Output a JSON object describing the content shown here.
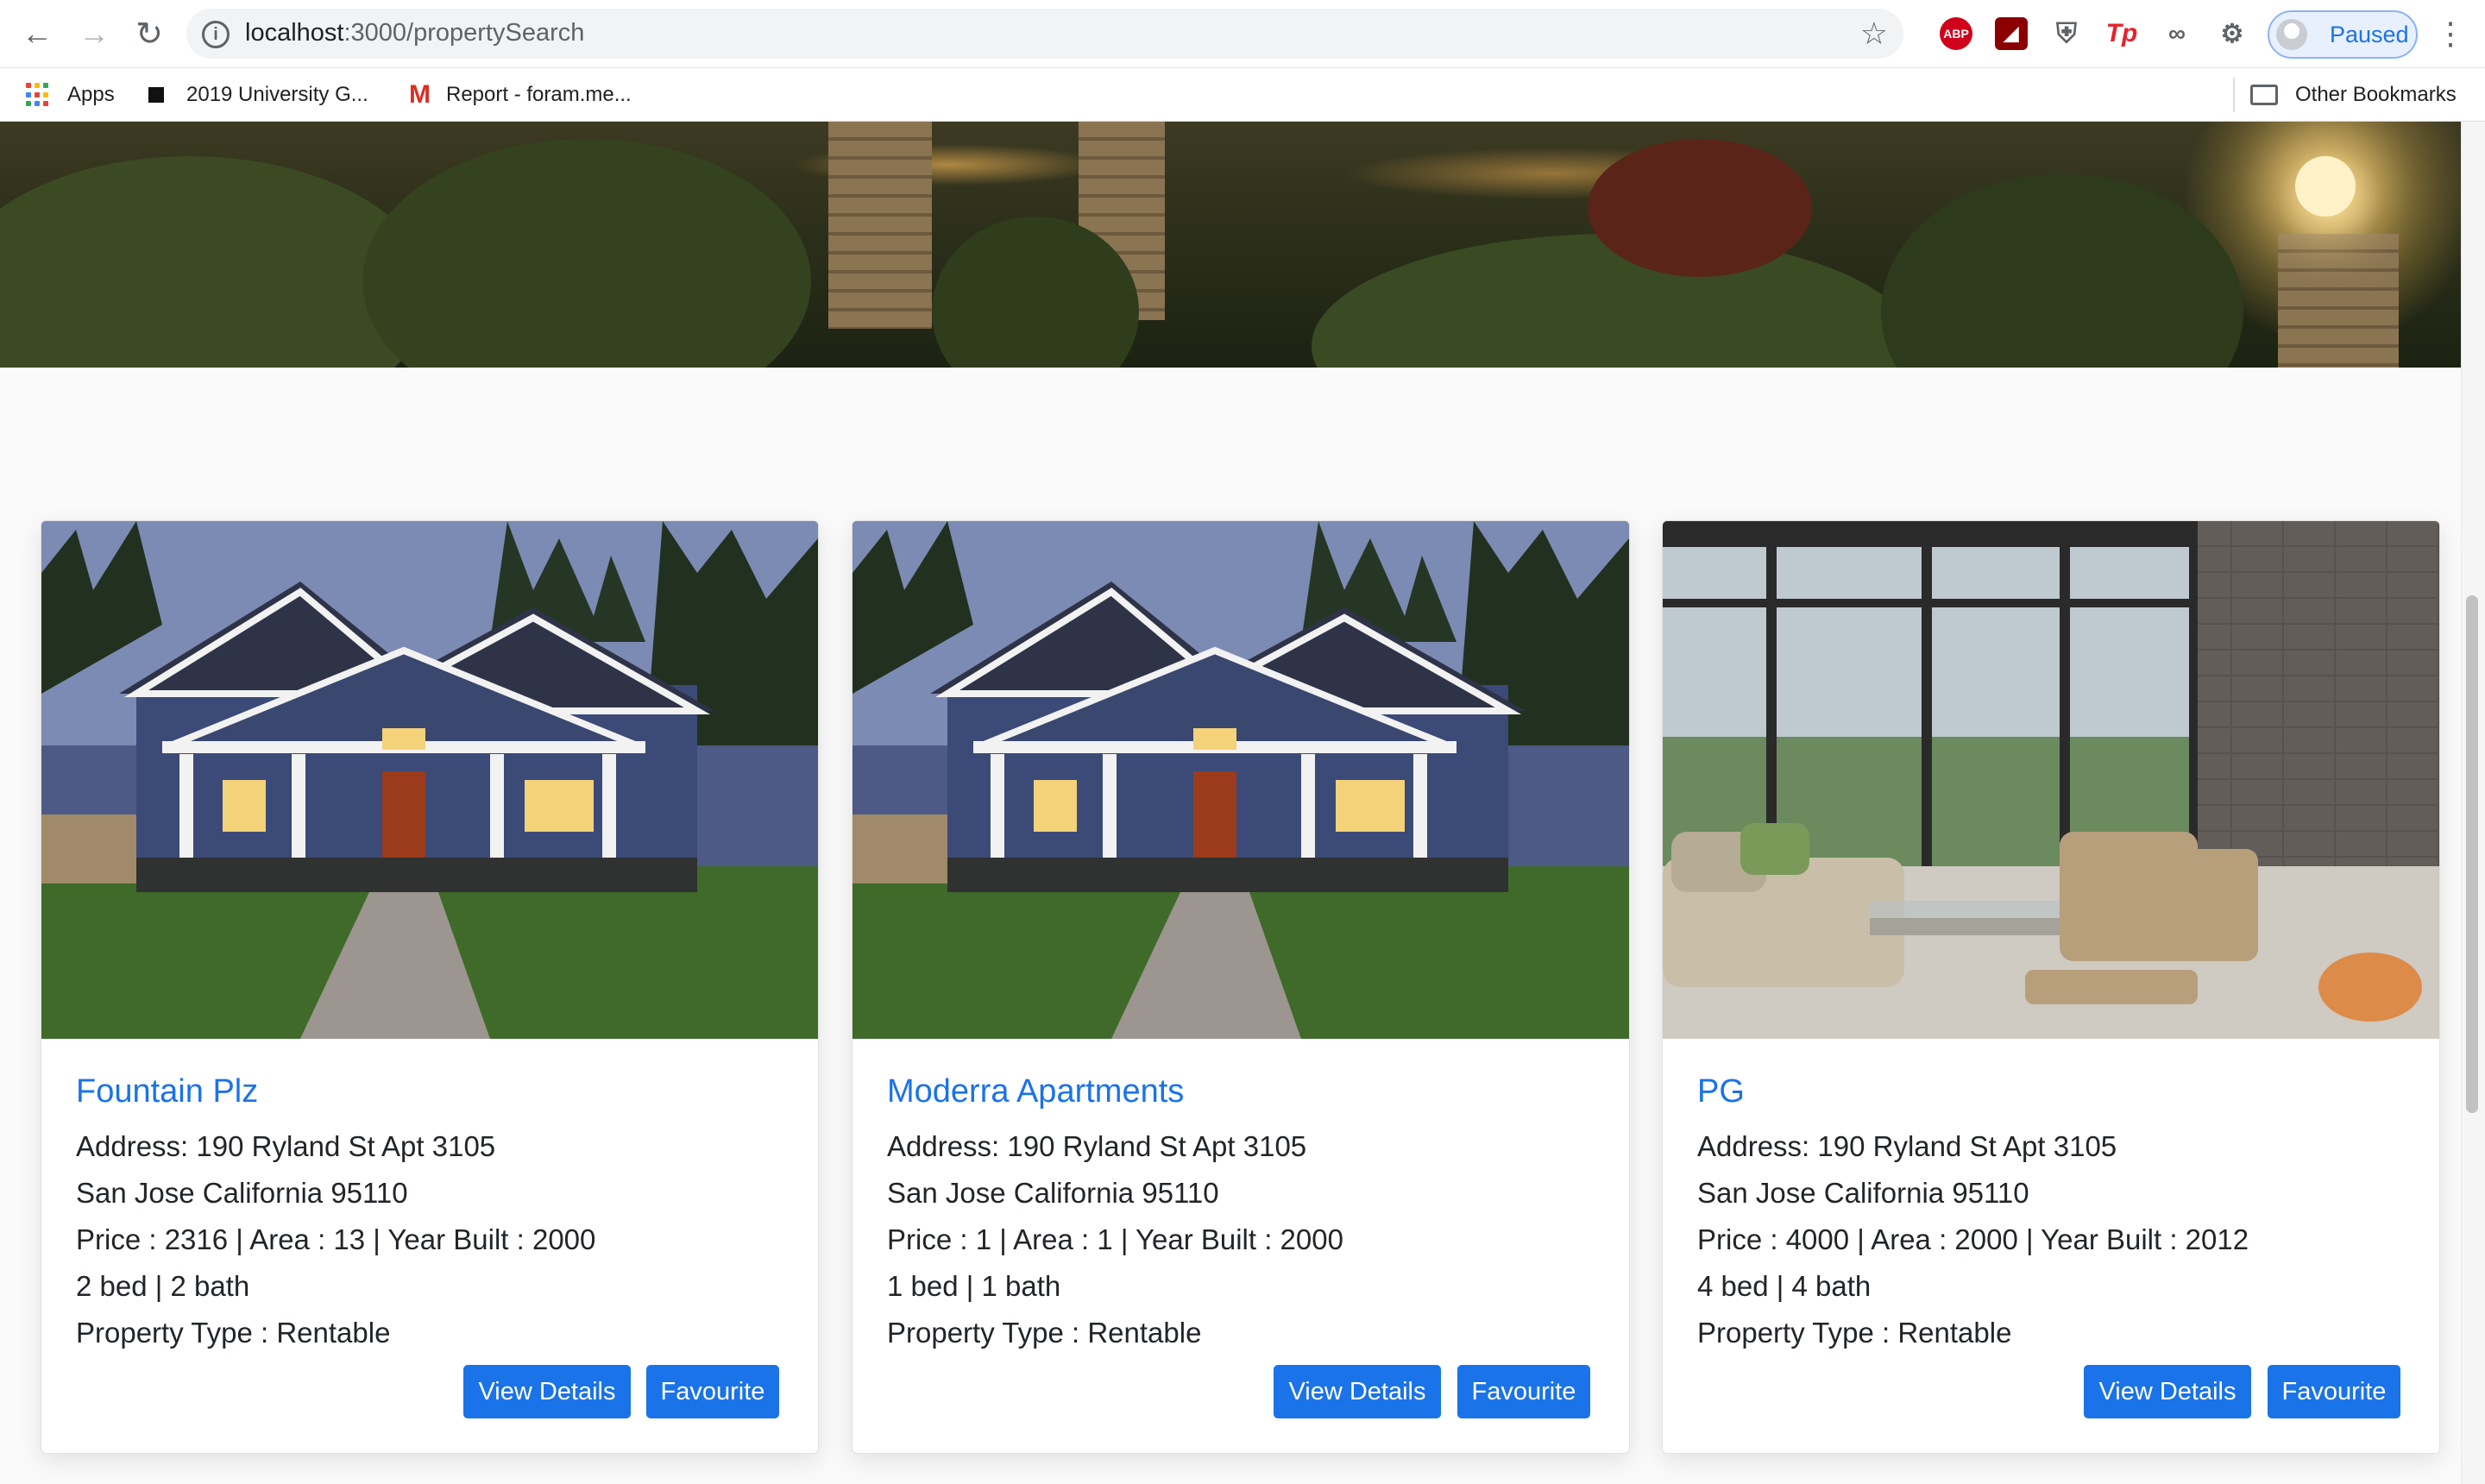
{
  "browser": {
    "url_host": "localhost",
    "url_path": ":3000/propertySearch",
    "profile_label": "Paused",
    "extensions": [
      "ABP",
      "Tp"
    ],
    "bookmarks": [
      "Apps",
      "2019 University G...",
      "Report - foram.me..."
    ],
    "other_bookmarks": "Other Bookmarks"
  },
  "properties": [
    {
      "title": "Fountain Plz",
      "address": "Address: 190 Ryland St Apt 3105",
      "city_line": "San Jose California 95110",
      "details": "Price : 2316 | Area : 13 | Year Built : 2000",
      "bed_bath": "2 bed | 2 bath",
      "type": "Property Type : Rentable",
      "view_label": "View Details",
      "fav_label": "Favourite",
      "image": "house-exterior"
    },
    {
      "title": "Moderra Apartments",
      "address": "Address: 190 Ryland St Apt 3105",
      "city_line": "San Jose California 95110",
      "details": "Price : 1 | Area : 1 | Year Built : 2000",
      "bed_bath": "1 bed | 1 bath",
      "type": "Property Type : Rentable",
      "view_label": "View Details",
      "fav_label": "Favourite",
      "image": "house-exterior"
    },
    {
      "title": "PG",
      "address": "Address: 190 Ryland St Apt 3105",
      "city_line": "San Jose California 95110",
      "details": "Price : 4000 | Area : 2000 | Year Built : 2012",
      "bed_bath": "4 bed | 4 bath",
      "type": "Property Type : Rentable",
      "view_label": "View Details",
      "fav_label": "Favourite",
      "image": "living-room-interior"
    }
  ],
  "colors": {
    "accent": "#1a73e8",
    "text": "#212529"
  }
}
